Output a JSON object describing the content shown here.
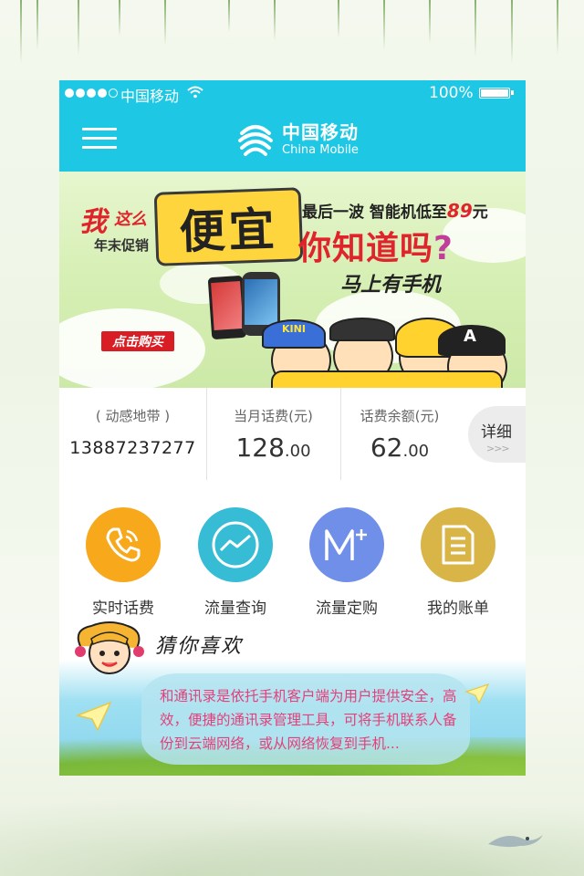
{
  "status_bar": {
    "carrier": "中国移动",
    "battery_percent": "100%",
    "signal_bars": 4,
    "signal_max": 5
  },
  "header": {
    "logo_cn": "中国移动",
    "logo_en": "China Mobile",
    "menu_icon": "hamburger-menu-icon"
  },
  "banner": {
    "wo": "我",
    "zheme": "这么",
    "nianmo": "年末促销",
    "pianyi": "便宜",
    "last_wave": "最后一波 智能机低至",
    "price": "89",
    "price_unit": "元",
    "ni_zhidao": "你知道吗",
    "qmark": "?",
    "mashang": "马上有手机",
    "buy_button": "点击购买",
    "hat_text_1": "KINI",
    "hat_text_2": "A"
  },
  "balance": {
    "plan_label": "( 动感地带 )",
    "phone_number": "13887237277",
    "month_fee_label": "当月话费(元)",
    "month_fee_int": "128",
    "month_fee_dec": ".00",
    "remaining_label": "话费余额(元)",
    "remaining_int": "62",
    "remaining_dec": ".00",
    "detail_label": "详细",
    "detail_arrows": ">>>"
  },
  "quick_actions": [
    {
      "label": "实时话费",
      "icon": "phone-call-icon",
      "color": "#f7a81b"
    },
    {
      "label": "流量查询",
      "icon": "traffic-chart-icon",
      "color": "#36bcd4"
    },
    {
      "label": "流量定购",
      "icon": "m-plus-icon",
      "color": "#6f8fe8"
    },
    {
      "label": "我的账单",
      "icon": "bill-document-icon",
      "color": "#d8b546"
    }
  ],
  "recommend": {
    "title": "猜你喜欢",
    "text": "和通讯录是依托手机客户端为用户提供安全，高效，便捷的通讯录管理工具，可将手机联系人备份到云端网络，或从网络恢复到手机..."
  },
  "colors": {
    "header": "#1ec8e4",
    "accent_red": "#e0242b",
    "recommend_text": "#e3407a"
  }
}
